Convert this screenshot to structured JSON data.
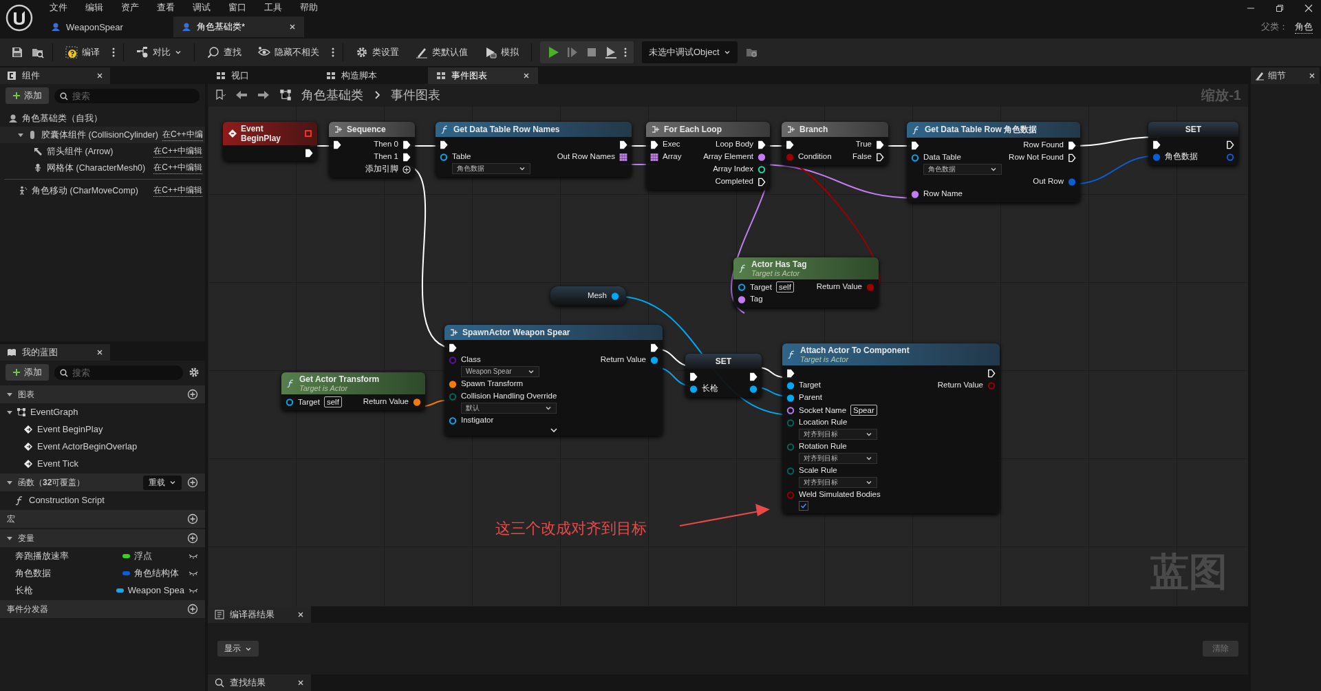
{
  "title_bar": {
    "menus": [
      "文件",
      "编辑",
      "资产",
      "查看",
      "调试",
      "窗口",
      "工具",
      "帮助"
    ],
    "doc_tabs": [
      {
        "label": "WeaponSpear",
        "selected": false
      },
      {
        "label": "角色基础类*",
        "selected": true
      }
    ],
    "parent_label": "父类：",
    "parent_value": "角色"
  },
  "toolbar": {
    "compile": "编译",
    "diff": "对比",
    "find": "查找",
    "hide_unrelated": "隐藏不相关",
    "class_settings": "类设置",
    "class_defaults": "类默认值",
    "simulate": "模拟",
    "debug_object": "未选中调试Object"
  },
  "components": {
    "title": "组件",
    "add": "添加",
    "search_placeholder": "搜索",
    "tree": [
      {
        "label": "角色基础类（自我）",
        "children": [
          {
            "label": "胶囊体组件 (CollisionCylinder)",
            "link": "在C++中编",
            "expanded": true,
            "children": [
              {
                "label": "箭头组件 (Arrow)",
                "link": "在C++中编辑"
              },
              {
                "label": "网格体 (CharacterMesh0)",
                "link": "在C++中编辑"
              }
            ]
          }
        ]
      }
    ],
    "others": [
      {
        "label": "角色移动 (CharMoveComp)",
        "link": "在C++中编辑"
      }
    ]
  },
  "my_blueprint": {
    "title": "我的蓝图",
    "add": "添加",
    "search_placeholder": "搜索",
    "sections": [
      {
        "kind": "tree",
        "title": "图表",
        "expanded": true,
        "items": [
          {
            "label": "EventGraph",
            "expanded": true,
            "children": [
              "Event BeginPlay",
              "Event ActorBeginOverlap",
              "Event Tick"
            ]
          }
        ]
      },
      {
        "kind": "list",
        "title": "函数（**32**可覆盖）",
        "expanded": true,
        "override": "重载",
        "items": [
          "Construction Script"
        ]
      },
      {
        "kind": "list",
        "title": "宏"
      },
      {
        "kind": "variables",
        "title": "变量",
        "expanded": true,
        "vars": [
          {
            "name": "奔跑播放速率",
            "type": "浮点",
            "color": "#3bd11a"
          },
          {
            "name": "角色数据",
            "type": "角色结构体",
            "color": "#0a5ed6"
          },
          {
            "name": "长枪",
            "type": "Weapon Spea",
            "color": "#14a8f0"
          }
        ]
      },
      {
        "kind": "list",
        "title": "事件分发器"
      }
    ]
  },
  "graph_tabs": [
    {
      "label": "视口",
      "selected": false
    },
    {
      "label": "构造脚本",
      "selected": false
    },
    {
      "label": "事件图表",
      "selected": true
    }
  ],
  "breadcrumb": [
    "角色基础类",
    "事件图表"
  ],
  "graph": {
    "zoom_label": "缩放-1",
    "watermark": "蓝图",
    "annotation": "这三个改成对齐到目标",
    "nodes": [
      {
        "kind": "event",
        "title": "Event BeginPlay",
        "rows": [
          {
            "right": {
              "kind": "exec",
              "linked": true
            }
          }
        ]
      },
      {
        "kind": "flow",
        "title": "Sequence",
        "rows": [
          {
            "left": {
              "kind": "exec",
              "linked": true
            },
            "right": {
              "label": "Then 0",
              "kind": "exec",
              "linked": true
            }
          },
          {
            "right": {
              "label": "Then 1",
              "kind": "exec",
              "linked": true
            }
          },
          {
            "right": {
              "label": "添加引脚",
              "kind": "add"
            }
          }
        ]
      },
      {
        "kind": "function",
        "title": "Get Data Table Row Names",
        "rows": [
          {
            "left": {
              "kind": "exec",
              "linked": true
            },
            "right": {
              "kind": "exec",
              "linked": true
            }
          },
          {
            "left": {
              "label": "Table",
              "kind": "object",
              "linked": false,
              "dropdown": "角色数据"
            },
            "right": {
              "label": "Out Row Names",
              "kind": "name_array",
              "linked": true
            }
          }
        ]
      },
      {
        "kind": "macro",
        "title": "For Each Loop",
        "rows": [
          {
            "left": {
              "label": "Exec",
              "kind": "exec",
              "linked": true
            },
            "right": {
              "label": "Loop Body",
              "kind": "exec",
              "linked": true
            }
          },
          {
            "left": {
              "label": "Array",
              "kind": "name_array",
              "linked": true
            },
            "right": {
              "label": "Array Element",
              "kind": "name",
              "linked": true
            }
          },
          {
            "right": {
              "label": "Array Index",
              "kind": "int",
              "linked": false
            }
          },
          {
            "right": {
              "label": "Completed",
              "kind": "exec",
              "linked": false
            }
          }
        ]
      },
      {
        "kind": "flow",
        "title": "Branch",
        "rows": [
          {
            "left": {
              "kind": "exec",
              "linked": true
            },
            "right": {
              "label": "True",
              "kind": "exec",
              "linked": true
            }
          },
          {
            "left": {
              "label": "Condition",
              "kind": "bool",
              "linked": true
            },
            "right": {
              "label": "False",
              "kind": "exec",
              "linked": false
            }
          }
        ]
      },
      {
        "kind": "function",
        "title": "Get Data Table Row 角色数据",
        "rows": [
          {
            "left": {
              "kind": "exec",
              "linked": true
            },
            "right": {
              "label": "Row Found",
              "kind": "exec",
              "linked": true
            }
          },
          {
            "left": {
              "label": "Data Table",
              "kind": "object",
              "linked": false,
              "dropdown": "角色数据"
            },
            "right": {
              "label": "Row Not Found",
              "kind": "exec",
              "linked": false
            }
          },
          {
            "right": {
              "label": "Out Row",
              "kind": "struct",
              "linked": true
            }
          },
          {
            "left": {
              "label": "Row Name",
              "kind": "name",
              "linked": true
            }
          }
        ]
      },
      {
        "kind": "set",
        "title": "SET",
        "rows": [
          {
            "left": {
              "kind": "exec",
              "linked": true
            },
            "right": {
              "kind": "exec",
              "linked": false
            }
          },
          {
            "left": {
              "label": "角色数据",
              "kind": "struct",
              "linked": true
            },
            "right": {
              "kind": "struct",
              "linked": false
            }
          }
        ]
      },
      {
        "kind": "getter",
        "rows": [
          {
            "right": {
              "label": "Mesh",
              "kind": "object",
              "linked": true
            }
          }
        ]
      },
      {
        "kind": "pure",
        "title": "Actor Has Tag",
        "subtitle": "Target is Actor",
        "rows": [
          {
            "left": {
              "label": "Target",
              "kind": "object",
              "linked": false,
              "default": "self"
            },
            "right": {
              "label": "Return Value",
              "kind": "bool",
              "linked": true
            }
          },
          {
            "left": {
              "label": "Tag",
              "kind": "name",
              "linked": true
            }
          }
        ]
      },
      {
        "kind": "pure",
        "title": "Get Actor Transform",
        "subtitle": "Target is Actor",
        "rows": [
          {
            "left": {
              "label": "Target",
              "kind": "object",
              "linked": false,
              "default": "self"
            },
            "right": {
              "label": "Return Value",
              "kind": "transform",
              "linked": true
            }
          }
        ]
      },
      {
        "kind": "spawn",
        "title": "SpawnActor Weapon Spear",
        "advanced": true,
        "rows": [
          {
            "left": {
              "kind": "exec",
              "linked": true
            },
            "right": {
              "kind": "exec",
              "linked": true
            }
          },
          {
            "left": {
              "label": "Class",
              "kind": "class",
              "linked": false,
              "dropdown": "Weapon Spear"
            },
            "right": {
              "label": "Return Value",
              "kind": "object",
              "linked": true
            }
          },
          {
            "left": {
              "label": "Spawn Transform",
              "kind": "transform",
              "linked": true
            }
          },
          {
            "left": {
              "label": "Collision Handling Override",
              "kind": "enum",
              "linked": false,
              "dropdown": "默认"
            }
          },
          {
            "left": {
              "label": "Instigator",
              "kind": "object",
              "linked": false
            }
          }
        ]
      },
      {
        "kind": "set",
        "title": "SET",
        "rows": [
          {
            "left": {
              "kind": "exec",
              "linked": true
            },
            "right": {
              "kind": "exec",
              "linked": true
            }
          },
          {
            "left": {
              "label": "长枪",
              "kind": "object",
              "linked": true
            },
            "right": {
              "kind": "object",
              "linked": true
            }
          }
        ]
      },
      {
        "kind": "function",
        "title": "Attach Actor To Component",
        "subtitle": "Target is Actor",
        "rows": [
          {
            "left": {
              "kind": "exec",
              "linked": true
            },
            "right": {
              "kind": "exec",
              "linked": false
            }
          },
          {
            "left": {
              "label": "Target",
              "kind": "object",
              "linked": true
            },
            "right": {
              "label": "Return Value",
              "kind": "bool",
              "linked": false
            }
          },
          {
            "left": {
              "label": "Parent",
              "kind": "object",
              "linked": true
            }
          },
          {
            "left": {
              "label": "Socket Name",
              "kind": "name",
              "linked": false,
              "default": "Spear"
            }
          },
          {
            "left": {
              "label": "Location Rule",
              "kind": "enum",
              "linked": false,
              "dropdown": "对齐到目标"
            }
          },
          {
            "left": {
              "label": "Rotation Rule",
              "kind": "enum",
              "linked": false,
              "dropdown": "对齐到目标"
            }
          },
          {
            "left": {
              "label": "Scale Rule",
              "kind": "enum",
              "linked": false,
              "dropdown": "对齐到目标"
            }
          },
          {
            "left": {
              "label": "Weld Simulated Bodies",
              "kind": "bool",
              "linked": false,
              "checked": true
            }
          }
        ]
      }
    ]
  },
  "details": {
    "title": "细节"
  },
  "bottom": {
    "compiler_tab": "编译器结果",
    "show": "显示",
    "clear": "清除",
    "find_tab": "查找结果"
  }
}
